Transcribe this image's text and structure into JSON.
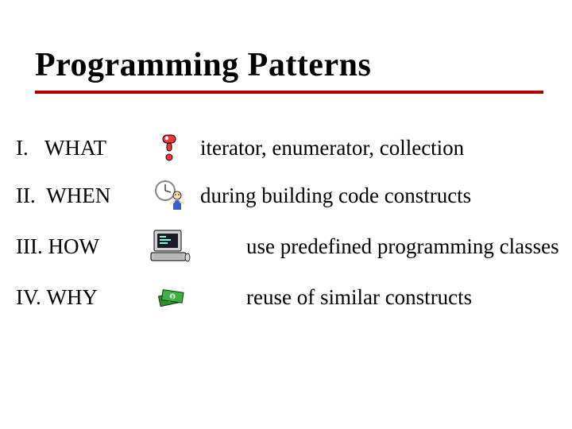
{
  "title": "Programming Patterns",
  "rows": [
    {
      "num": "I.",
      "label": "WHAT",
      "desc": "iterator, enumerator, collection"
    },
    {
      "num": "II.",
      "label": "WHEN",
      "desc": "during building code constructs"
    },
    {
      "num": "III.",
      "label": "HOW",
      "desc": "use predefined programming classes"
    },
    {
      "num": "IV.",
      "label": "WHY",
      "desc": "reuse of similar constructs"
    }
  ]
}
